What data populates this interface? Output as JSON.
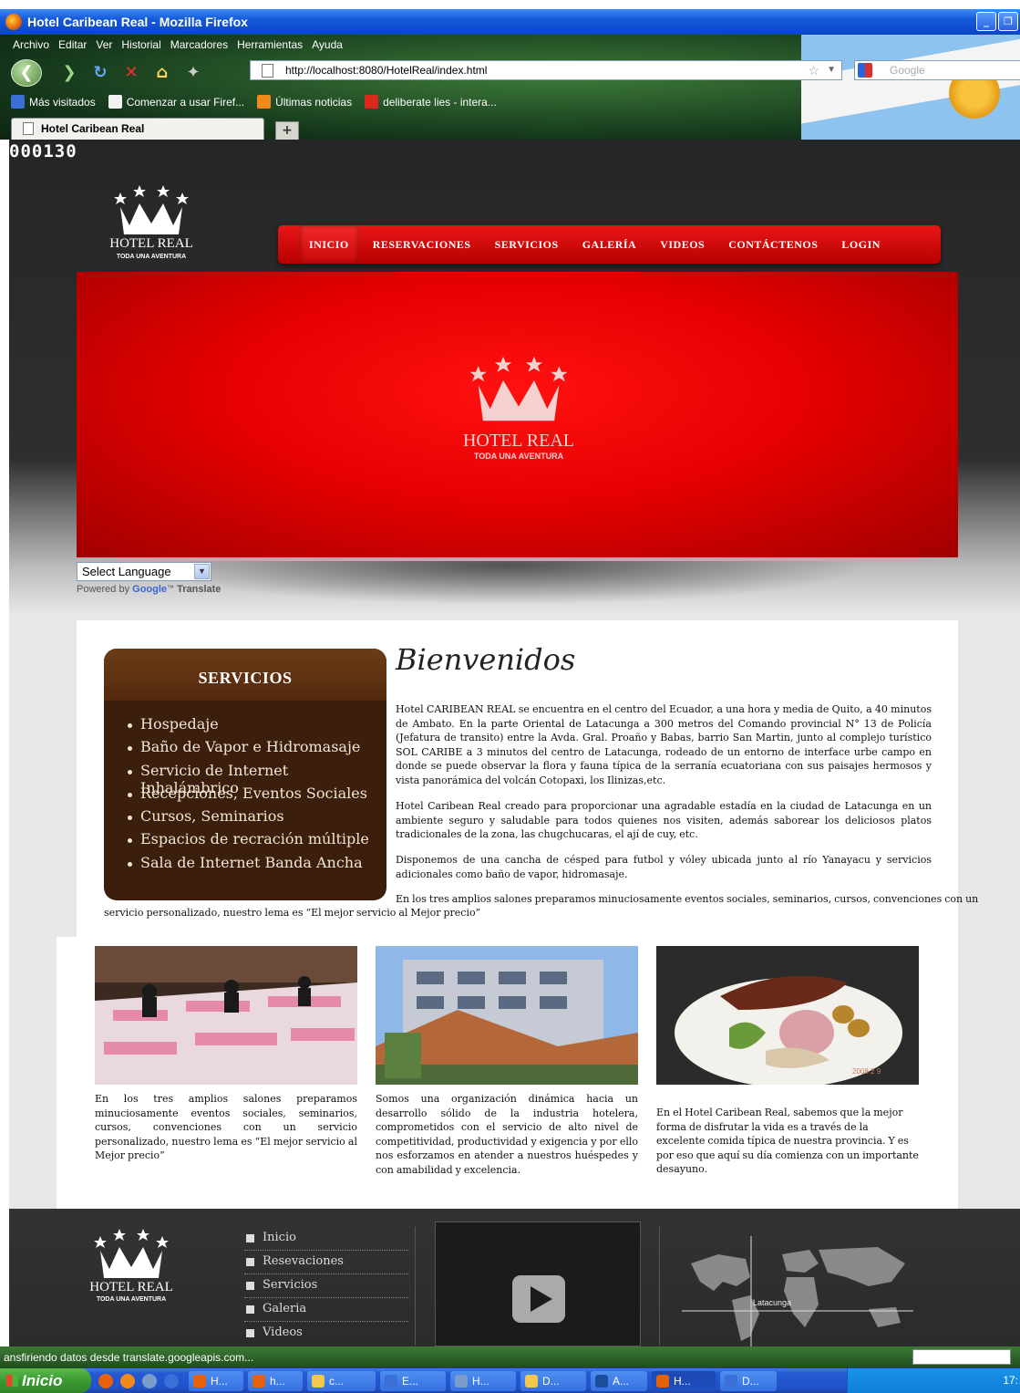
{
  "window": {
    "title": "Hotel Caribean Real - Mozilla Firefox",
    "min": "_",
    "max": "❐"
  },
  "menubar": [
    "Archivo",
    "Editar",
    "Ver",
    "Historial",
    "Marcadores",
    "Herramientas",
    "Ayuda"
  ],
  "navbar": {
    "url": "http://localhost:8080/HotelReal/index.html",
    "search_placeholder": "Google",
    "search_engine": "Google"
  },
  "bookmarks": [
    {
      "label": "Más visitados",
      "color": "#3a6fd8"
    },
    {
      "label": "Comenzar a usar Firef...",
      "color": "#f2f2f2"
    },
    {
      "label": "Últimas noticias",
      "color": "#f08a1c"
    },
    {
      "label": "deliberate lies - intera...",
      "color": "#d9281c"
    }
  ],
  "tab": {
    "title": "Hotel Caribean Real",
    "new_tab": "+"
  },
  "page": {
    "counter": "000130",
    "logo": {
      "name": "HOTEL REAL",
      "tagline": "TODA UNA AVENTURA"
    },
    "nav": [
      "INICIO",
      "RESERVACIONES",
      "SERVICIOS",
      "GALERÍA",
      "VIDEOS",
      "CONTÁCTENOS",
      "LOGIN"
    ],
    "translate": {
      "select": "Select Language",
      "powered": "Powered by",
      "google": "Google",
      "tm": "™",
      "translate": "Translate"
    },
    "services": {
      "title": "SERVICIOS",
      "items": [
        "Hospedaje",
        "Baño de Vapor e Hidromasaje",
        "Servicio de Internet Inhalámbrico",
        "Recepciones, Eventos Sociales",
        "Cursos, Seminarios",
        "Espacios de recración múltiple",
        "Sala de Internet Banda Ancha"
      ]
    },
    "welcome": "Bienvenidos",
    "paragraphs": [
      "Hotel CARIBEAN REAL se encuentra en el centro del Ecuador, a una hora y media de Quito, a 40 minutos de Ambato. En la parte Oriental de Latacunga a 300 metros del Comando provincial N° 13 de Policía (Jefatura de transito) entre la Avda. Gral. Proaño y Babas, barrio San Martin, junto al complejo turístico SOL CARIBE a 3 minutos del centro de Latacunga, rodeado de un entorno de interface urbe campo en donde se puede observar la flora y fauna típica de la serranía ecuatoriana con sus paisajes hermosos y vista panorámica del volcán Cotopaxi, los Ilinizas,etc.",
      "Hotel Caribean Real creado para proporcionar una agradable estadía en la ciudad de Latacunga en un ambiente seguro y saludable para todos quienes nos visiten, además saborear los deliciosos platos tradicionales de la zona, las chugchucaras, el ají de cuy, etc.",
      "Disponemos de una cancha de césped para futbol y vóley ubicada junto al río Yanayacu y servicios adicionales como baño de vapor, hidromasaje.",
      "En los tres amplios salones preparamos minuciosamente eventos sociales, seminarios, cursos, convenciones con un",
      "servicio personalizado, nuestro lema es “El mejor servicio al Mejor precio”"
    ],
    "gallery": [
      {
        "text": "En los tres amplios salones preparamos minuciosamente eventos sociales, seminarios, cursos, convenciones con un servicio personalizado, nuestro lema es “El mejor servicio al Mejor precio”"
      },
      {
        "text": "Somos una organización dinámica hacia un desarrollo sólido de la industria hotelera, comprometidos con el servicio de alto nivel de competitividad, productividad y exigencia y por ello nos esforzamos en atender a nuestros huéspedes y con amabilidad y excelencia."
      },
      {
        "text": "En el Hotel Caribean Real, sabemos que la mejor forma de disfrutar la vida es a través de la excelente comida típica de nuestra provincia. Y es por eso que aquí su día comienza con un importante desayuno.",
        "stamp": "2008 2 9"
      }
    ],
    "footer": {
      "links": [
        "Inicio",
        "Resevaciones",
        "Servicios",
        "Galeria",
        "Videos"
      ],
      "map_label": "Latacunga"
    }
  },
  "status": "ansfiriendo datos desde translate.googleapis.com...",
  "taskbar": {
    "start": "Inicio",
    "items": [
      {
        "label": "H...",
        "color": "#e5620b"
      },
      {
        "label": "h...",
        "color": "#e5620b"
      },
      {
        "label": "c...",
        "color": "#f2c94c"
      },
      {
        "label": "E...",
        "color": "#3a6fd8"
      },
      {
        "label": "H...",
        "color": "#7a9cc8"
      },
      {
        "label": "D...",
        "color": "#f2c94c"
      },
      {
        "label": "A...",
        "color": "#1b4e9a"
      },
      {
        "label": "H...",
        "color": "#e5620b"
      },
      {
        "label": "D...",
        "color": "#3a6fd8"
      }
    ],
    "clock": "17:"
  }
}
